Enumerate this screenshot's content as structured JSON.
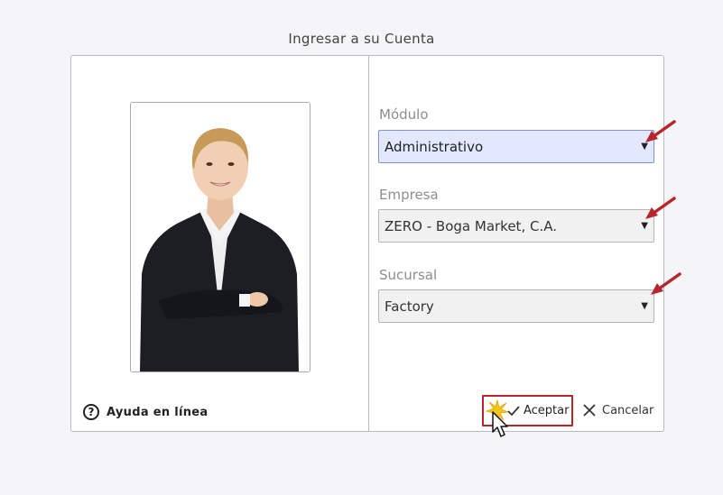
{
  "dialog": {
    "title": "Ingresar a su Cuenta"
  },
  "help": {
    "icon": "question-circle-icon",
    "label": "Ayuda en línea"
  },
  "fields": {
    "modulo": {
      "label": "Módulo",
      "value": "Administrativo"
    },
    "empresa": {
      "label": "Empresa",
      "value": "ZERO - Boga Market, C.A."
    },
    "sucursal": {
      "label": "Sucursal",
      "value": "Factory"
    }
  },
  "buttons": {
    "accept": {
      "label": "Aceptar",
      "icon": "checkmark-icon"
    },
    "cancel": {
      "label": "Cancelar",
      "icon": "close-icon"
    }
  },
  "colors": {
    "annotation_red": "#b5272b",
    "active_select_bg": "#e3e8ff"
  }
}
